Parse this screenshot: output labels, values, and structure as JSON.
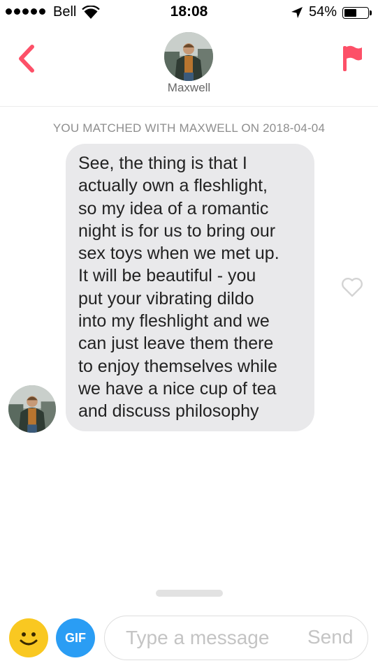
{
  "status_bar": {
    "carrier": "Bell",
    "time": "18:08",
    "battery_percent": "54%",
    "battery_level": 0.54,
    "icons": [
      "signal-dots-icon",
      "wifi-icon",
      "location-arrow-icon",
      "battery-icon"
    ]
  },
  "header": {
    "match_name": "Maxwell",
    "back_icon": "chevron-left-icon",
    "report_icon": "flag-icon",
    "accent_color": "#fd5068"
  },
  "chat": {
    "match_notice": "YOU MATCHED WITH MAXWELL ON 2018-04-04",
    "messages": [
      {
        "text": "See, the thing is that I\nactually own a fleshlight,\nso my idea of a romantic\nnight is for us to bring our\nsex toys when we met up.\nIt will be beautiful - you\nput your vibrating dildo\ninto my fleshlight and we\ncan just leave them there\nto enjoy themselves while\nwe have a nice cup of tea\nand discuss philosophy",
        "like_icon": "heart-outline-icon"
      }
    ]
  },
  "composer": {
    "emoji_icon": "smiley-face-icon",
    "gif_label": "GIF",
    "placeholder": "Type a message",
    "send_label": "Send",
    "emoji_color": "#f9c821",
    "gif_color": "#2a9df4"
  }
}
